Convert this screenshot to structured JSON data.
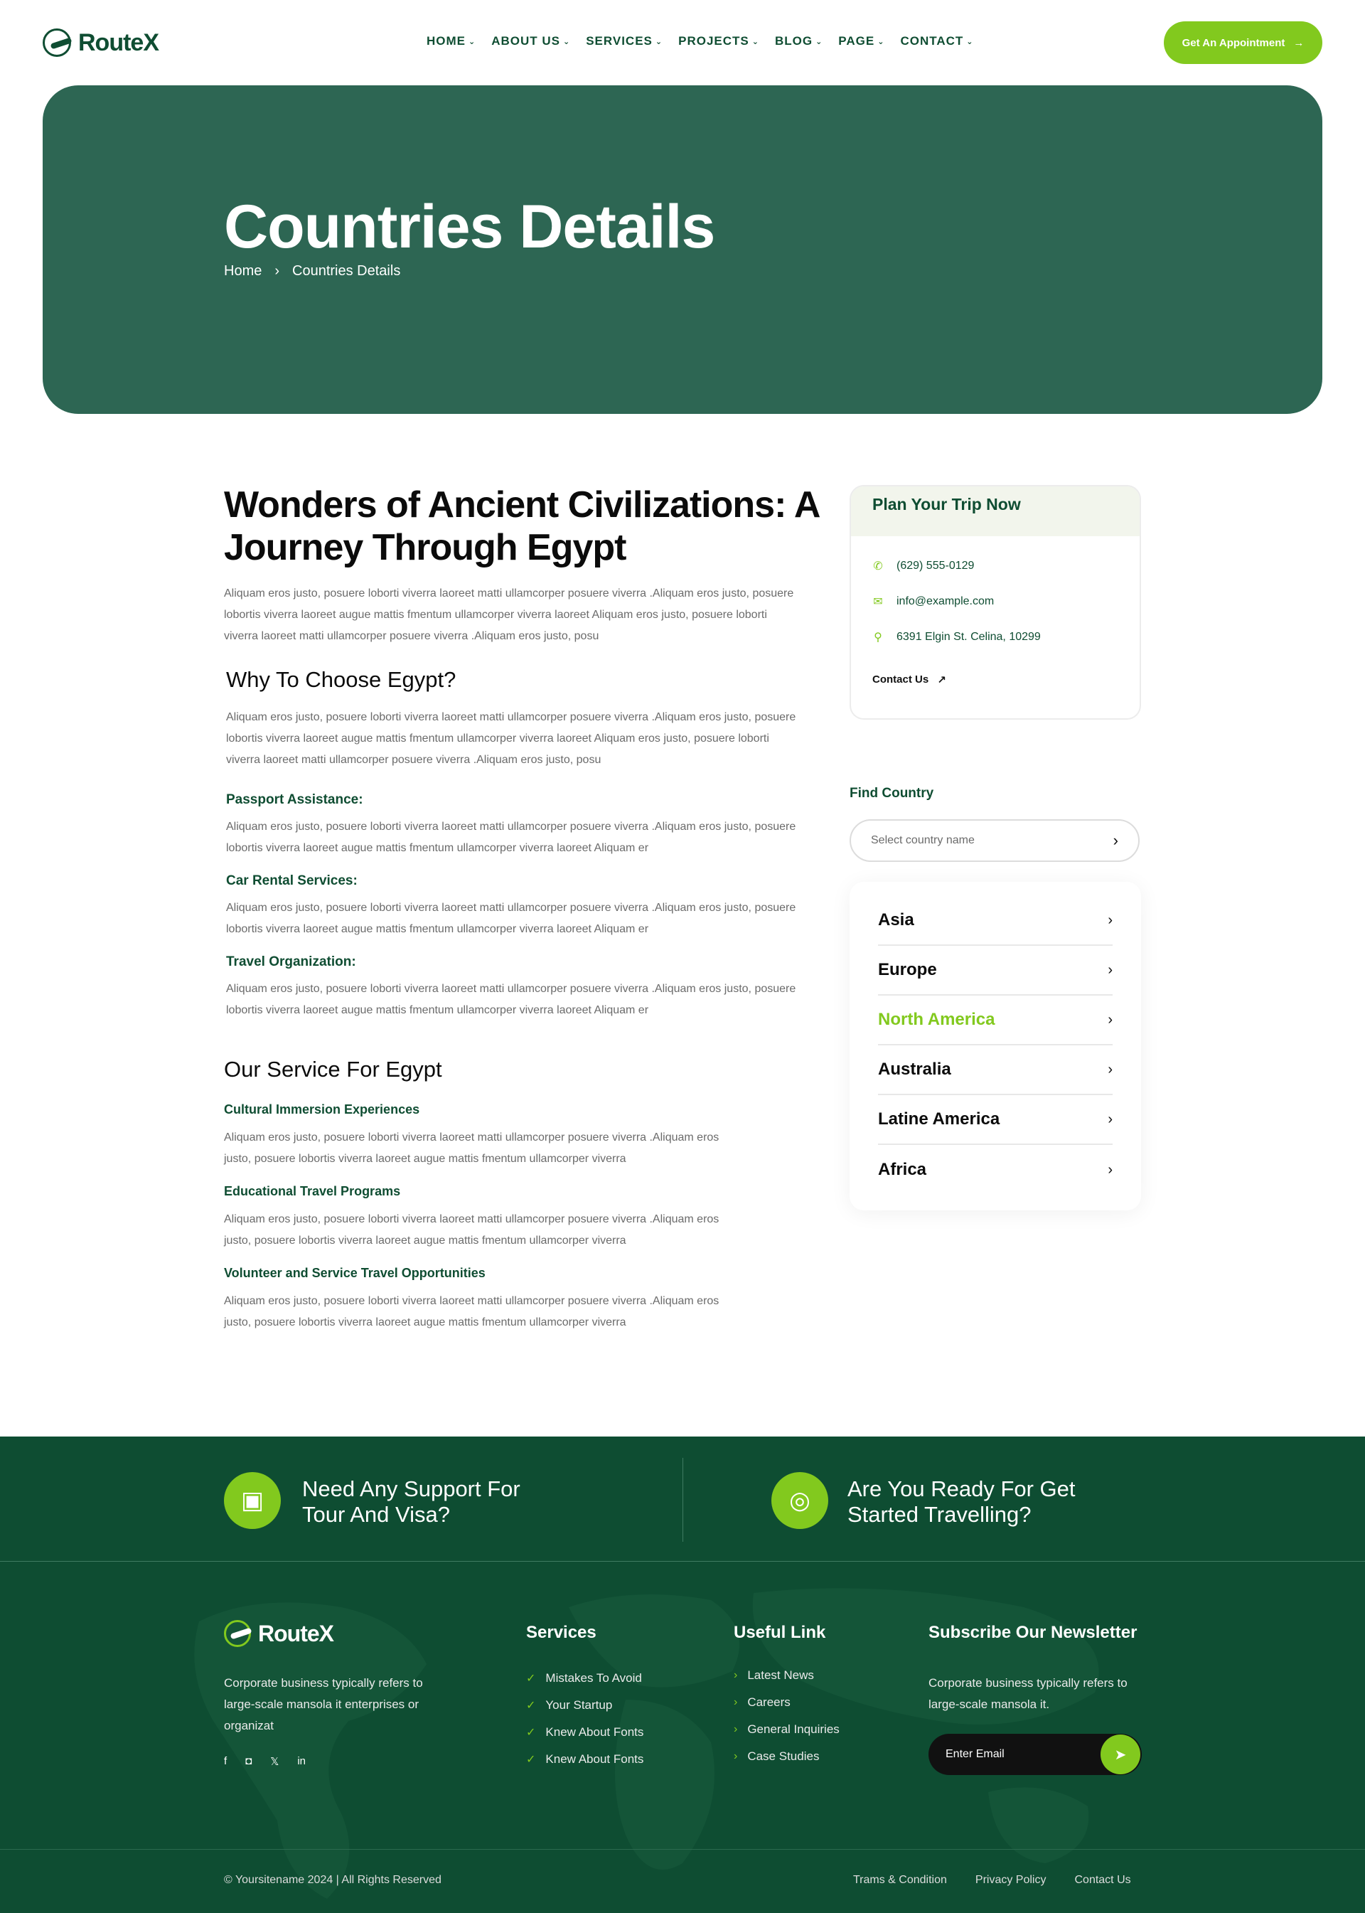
{
  "brand": {
    "name": "RouteX",
    "accent": "#82c91e",
    "primary": "#0f4d32",
    "hero_bg": "#2d6653"
  },
  "nav": {
    "items": [
      "HOME",
      "ABOUT US",
      "SERVICES",
      "PROJECTS",
      "BLOG",
      "PAGE",
      "CONTACT"
    ],
    "cta": "Get An Appointment"
  },
  "hero": {
    "title": "Countries Details",
    "breadcrumb": [
      "Home",
      "Countries Details"
    ]
  },
  "article": {
    "title_line1": "Wonders of Ancient Civilizations: A",
    "title_line2": "Journey Through Egypt",
    "intro_l1": "Aliquam eros justo, posuere loborti viverra laoreet matti ullamcorper posuere viverra .Aliquam eros justo, posuere",
    "intro_l2": "lobortis  viverra laoreet augue mattis fmentum ullamcorper viverra laoreet Aliquam eros justo, posuere loborti",
    "intro_l3": "viverra laoreet matti ullamcorper posuere viverra .Aliquam eros justo, posu",
    "why_title": "Why To Choose Egypt?",
    "why_l1": "Aliquam eros justo, posuere loborti viverra laoreet matti ullamcorper posuere viverra .Aliquam eros justo, posuere",
    "why_l2": "lobortis  viverra laoreet augue mattis fmentum ullamcorper viverra laoreet Aliquam eros justo, posuere loborti",
    "why_l3": "viverra laoreet matti ullamcorper posuere viverra .Aliquam eros justo, posu",
    "features": [
      {
        "title": "Passport Assistance:",
        "l1": "Aliquam eros justo, posuere loborti viverra laoreet matti ullamcorper posuere viverra .Aliquam eros justo, posuere",
        "l2": "lobortis  viverra laoreet augue mattis fmentum ullamcorper viverra laoreet Aliquam er"
      },
      {
        "title": "Car Rental Services:",
        "l1": "Aliquam eros justo, posuere loborti viverra laoreet matti ullamcorper posuere viverra .Aliquam eros justo, posuere",
        "l2": "lobortis  viverra laoreet augue mattis fmentum ullamcorper viverra laoreet Aliquam er"
      },
      {
        "title": "Travel Organization:",
        "l1": "Aliquam eros justo, posuere loborti viverra laoreet matti ullamcorper posuere viverra .Aliquam eros justo, posuere",
        "l2": "lobortis  viverra laoreet augue mattis fmentum ullamcorper viverra laoreet Aliquam er"
      }
    ],
    "service_title": "Our Service For Egypt",
    "services": [
      {
        "title": "Cultural Immersion Experiences",
        "l1": "Aliquam eros justo, posuere loborti viverra laoreet matti ullamcorper posuere viverra .Aliquam eros",
        "l2": "justo, posuere lobortis  viverra laoreet augue mattis fmentum ullamcorper viverra"
      },
      {
        "title": "Educational Travel Programs",
        "l1": "Aliquam eros justo, posuere loborti viverra laoreet matti ullamcorper posuere viverra .Aliquam eros",
        "l2": "justo, posuere lobortis  viverra laoreet augue mattis fmentum ullamcorper viverra"
      },
      {
        "title": "Volunteer and Service Travel Opportunities",
        "l1": "Aliquam eros justo, posuere loborti viverra laoreet matti ullamcorper posuere viverra .Aliquam eros",
        "l2": "justo, posuere lobortis  viverra laoreet augue mattis fmentum ullamcorper viverra"
      }
    ]
  },
  "sidebar": {
    "plan_title": "Plan Your Trip Now",
    "phone": "(629) 555-0129",
    "email": "info@example.com",
    "address": "6391 Elgin St. Celina, 10299",
    "contact_link": "Contact Us",
    "find_label": "Find Country",
    "find_placeholder": "Select country name",
    "countries": [
      "Asia",
      "Europe",
      "North America",
      "Australia",
      "Latine America",
      "Africa"
    ],
    "active_country": "North America"
  },
  "support": {
    "left_l1": "Need Any Support For",
    "left_l2": "Tour And Visa?",
    "right_l1": "Are You Ready For Get",
    "right_l2": "Started Travelling?"
  },
  "footer": {
    "about_l1": "Corporate business typically refers to",
    "about_l2": "large-scale mansola it enterprises or",
    "about_l3": "organizat",
    "services_title": "Services",
    "services": [
      "Mistakes To Avoid",
      "Your Startup",
      "Knew About Fonts",
      "Knew About Fonts"
    ],
    "useful_title": "Useful Link",
    "useful": [
      "Latest News",
      "Careers",
      "General Inquiries",
      "Case Studies"
    ],
    "newsletter_title": "Subscribe Our Newsletter",
    "newsletter_l1": "Corporate business typically refers to",
    "newsletter_l2": "large-scale mansola it.",
    "email_placeholder": "Enter Email",
    "copyright": "© Yoursitename  2024 | All Rights Reserved",
    "bottom_links": [
      "Trams & Condition",
      "Privacy Policy",
      "Contact Us"
    ]
  }
}
